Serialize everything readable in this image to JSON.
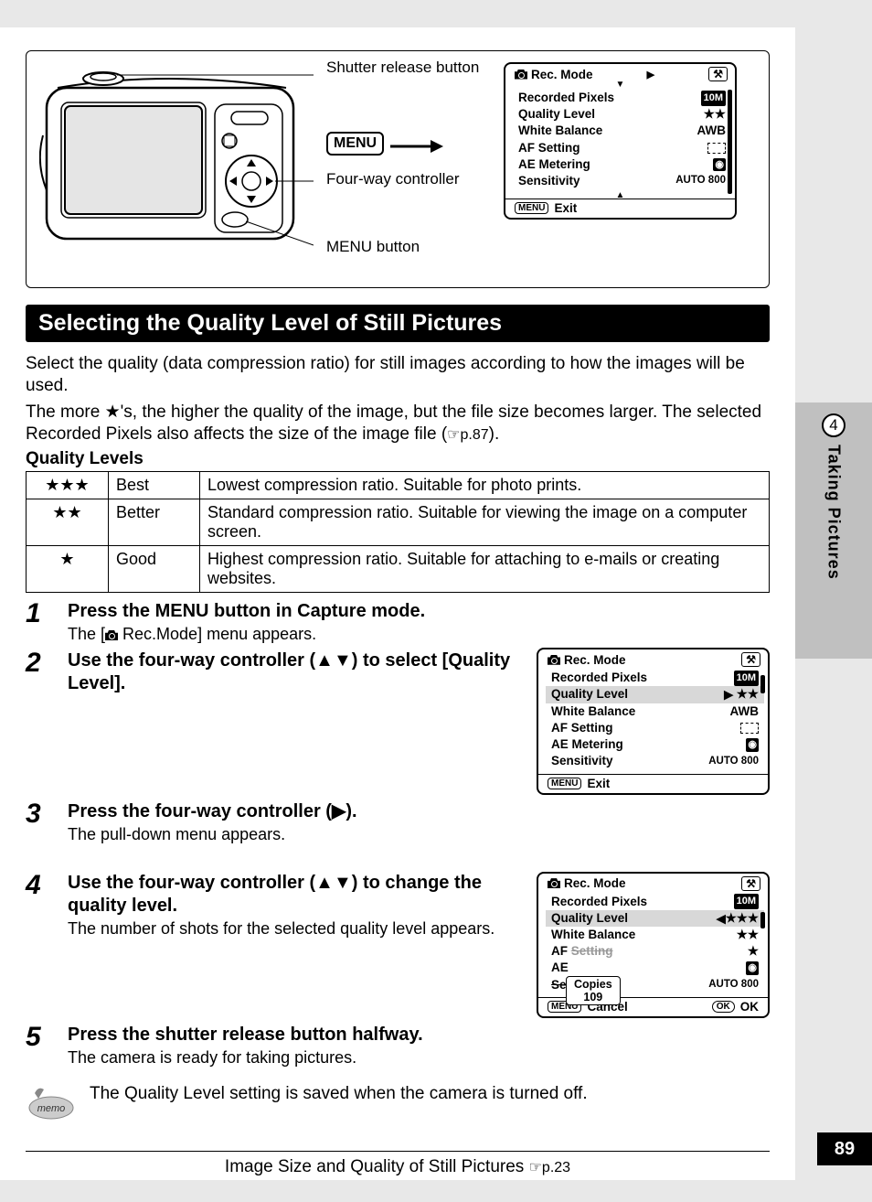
{
  "side_tab": {
    "chapter_num": "4",
    "chapter_title": "Taking Pictures"
  },
  "page_number": "89",
  "figure": {
    "callout_shutter": "Shutter release button",
    "callout_fourway": "Four-way controller",
    "callout_menu": "MENU button",
    "menu_badge": "MENU"
  },
  "lcd_common": {
    "header": "Rec. Mode",
    "rows": {
      "recorded_pixels": "Recorded Pixels",
      "quality_level": "Quality Level",
      "white_balance": "White Balance",
      "af_setting": "AF Setting",
      "ae_metering": "AE Metering",
      "sensitivity": "Sensitivity"
    },
    "vals": {
      "pixels": "10M",
      "ql2": "★★",
      "ql3": "★★★",
      "wb_awb": "AWB",
      "wb_stars": "★★",
      "af_star": "★",
      "sens": "AUTO 800"
    },
    "footer_exit": "Exit",
    "footer_cancel": "Cancel",
    "footer_ok": "OK",
    "menu_sm": "MENU",
    "ok_sm": "OK"
  },
  "popup": {
    "label": "Copies",
    "value": "109"
  },
  "lcd_step4_partial": {
    "ae_short": "AE",
    "sen_cut": "Sensitivity"
  },
  "section_title": "Selecting the Quality Level of Still Pictures",
  "intro": {
    "p1": "Select the quality (data compression ratio) for still images according to how the images will be used.",
    "p2a": "The more ",
    "p2_star": "★",
    "p2b": "'s, the higher the quality of the image, but the file size becomes larger. The selected Recorded Pixels also affects the size of the image file (",
    "p2_ref": "☞p.87",
    "p2c": ")."
  },
  "table_title": "Quality Levels",
  "table": [
    {
      "stars": "★★★",
      "name": "Best",
      "desc": "Lowest compression ratio. Suitable for photo prints."
    },
    {
      "stars": "★★",
      "name": "Better",
      "desc": "Standard compression ratio. Suitable for viewing the image on a computer screen."
    },
    {
      "stars": "★",
      "name": "Good",
      "desc": "Highest compression ratio. Suitable for attaching to e-mails or creating websites."
    }
  ],
  "steps": [
    {
      "n": "1",
      "title": "Press the MENU button in Capture mode.",
      "desc_a": "The [",
      "desc_b": " Rec.Mode] menu appears."
    },
    {
      "n": "2",
      "title": "Use the four-way controller (▲▼) to select [Quality Level]."
    },
    {
      "n": "3",
      "title": "Press the four-way controller (▶).",
      "desc": "The pull-down menu appears."
    },
    {
      "n": "4",
      "title": "Use the four-way controller (▲▼) to change the quality level.",
      "desc": "The number of shots for the selected quality level appears."
    },
    {
      "n": "5",
      "title": "Press the shutter release button halfway.",
      "desc": "The camera is ready for taking pictures."
    }
  ],
  "memo": "The Quality Level setting is saved when the camera is turned off.",
  "footer_ref": {
    "text": "Image Size and Quality of Still Pictures ",
    "page": "☞p.23"
  }
}
